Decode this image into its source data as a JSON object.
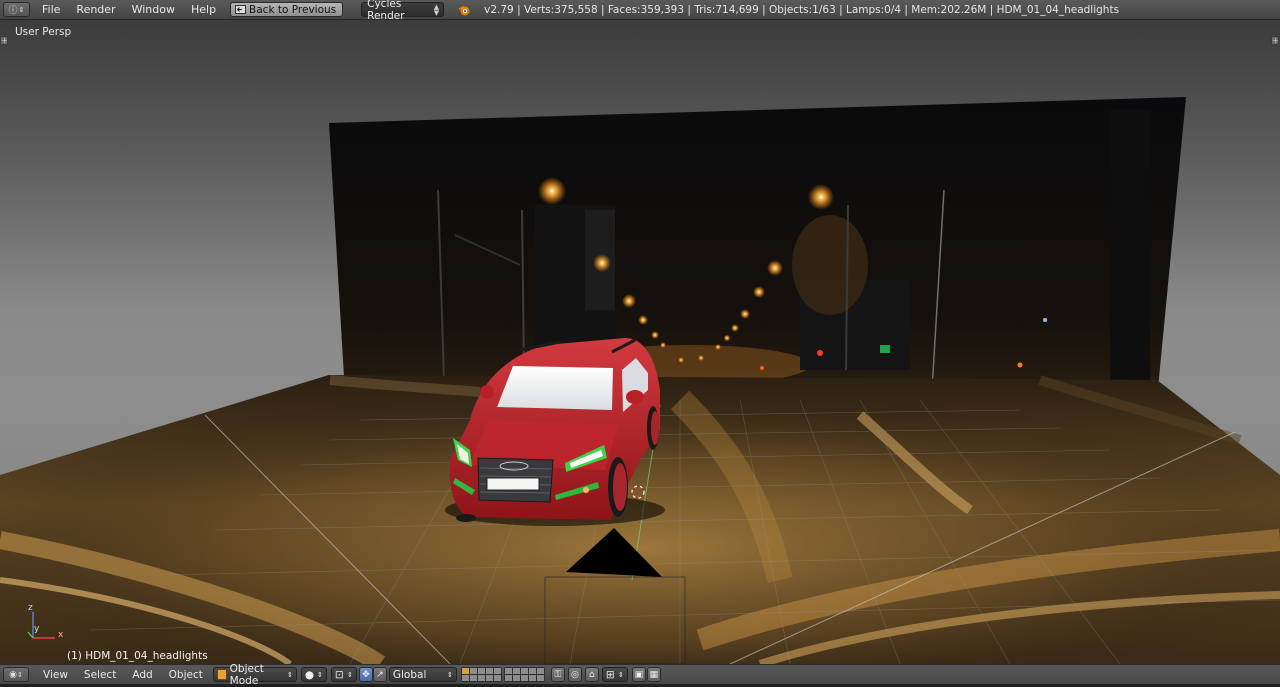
{
  "top_header": {
    "menus": [
      "File",
      "Render",
      "Window",
      "Help"
    ],
    "back_button_label": "Back to Previous",
    "render_engine": "Cycles Render",
    "stats": "v2.79 | Verts:375,558 | Faces:359,393 | Tris:714,699 | Objects:1/63 | Lamps:0/4 | Mem:202.26M | HDM_01_04_headlights"
  },
  "viewport": {
    "view_label": "User Persp",
    "active_object_label": "(1) HDM_01_04_headlights",
    "axis_labels": {
      "x": "x",
      "y": "y",
      "z": "z"
    }
  },
  "bottom_header": {
    "menus": [
      "View",
      "Select",
      "Add",
      "Object"
    ],
    "mode": "Object Mode",
    "orientation": "Global"
  },
  "colors": {
    "accent": "#5680c2",
    "active_layer": "#d6a33a",
    "car_body": "#b51f27",
    "headlight_glow": "#3fd24a"
  }
}
